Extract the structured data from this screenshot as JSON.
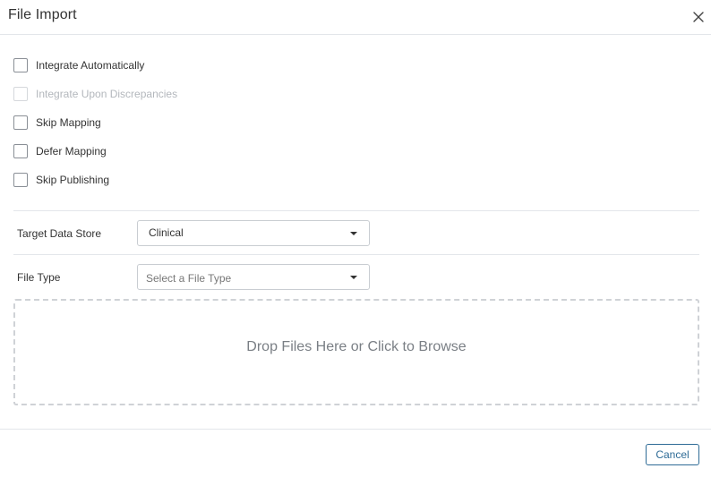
{
  "dialog": {
    "title": "File Import",
    "close_icon": "close-icon"
  },
  "options": [
    {
      "label": "Integrate Automatically",
      "checked": false,
      "disabled": false
    },
    {
      "label": "Integrate Upon Discrepancies",
      "checked": false,
      "disabled": true
    },
    {
      "label": "Skip Mapping",
      "checked": false,
      "disabled": false
    },
    {
      "label": "Defer Mapping",
      "checked": false,
      "disabled": false
    },
    {
      "label": "Skip Publishing",
      "checked": false,
      "disabled": false
    }
  ],
  "target_data_store": {
    "label": "Target Data Store",
    "value": "Clinical",
    "dropdown_icon": "caret-down-icon"
  },
  "file_type": {
    "label": "File Type",
    "placeholder": "Select a File Type",
    "dropdown_icon": "caret-down-icon"
  },
  "dropzone": {
    "text": "Drop Files Here or Click to Browse"
  },
  "footer": {
    "cancel_label": "Cancel"
  },
  "colors": {
    "accent": "#2e6b96",
    "border": "#e3e6ea",
    "dropzone_border": "#cfd2d6"
  }
}
